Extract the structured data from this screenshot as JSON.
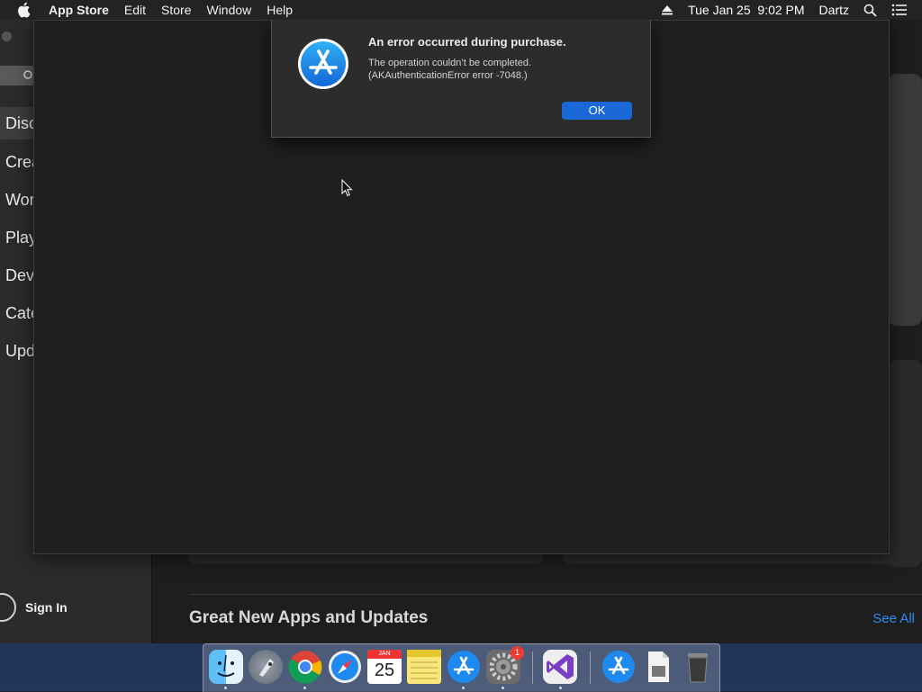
{
  "menubar": {
    "items": [
      "App Store",
      "Edit",
      "Store",
      "Window",
      "Help"
    ],
    "datetime": "Tue Jan 25  9:02 PM",
    "user": "Dartz"
  },
  "sidebar": {
    "items": [
      "Disc",
      "Crea",
      "Wor",
      "Play",
      "Dev",
      "Cate",
      "Upd"
    ],
    "sign_in": "Sign In"
  },
  "main": {
    "section_title": "Great New Apps and Updates",
    "see_all": "See All"
  },
  "dialog": {
    "title": "An error occurred during purchase.",
    "message": "The operation couldn’t be completed.\n(AKAuthenticationError error -7048.)",
    "ok_label": "OK"
  },
  "dock": {
    "calendar_month": "JAN",
    "calendar_day": "25",
    "settings_badge": "1",
    "items": [
      "finder-icon",
      "launchpad-icon",
      "chrome-icon",
      "safari-icon",
      "calendar-icon",
      "notes-icon",
      "app-store-icon",
      "system-preferences-icon",
      "visual-studio-icon",
      "app-store-download-icon",
      "document-icon",
      "trash-icon"
    ]
  },
  "colors": {
    "accent": "#1a67d8",
    "link": "#2d8cf0",
    "badge": "#ef3b33"
  }
}
